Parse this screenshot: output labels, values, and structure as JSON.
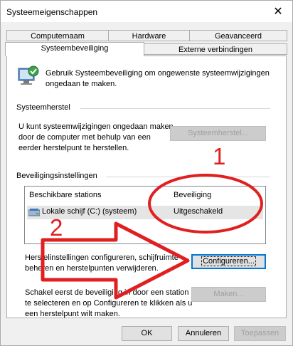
{
  "window": {
    "title": "Systeemeigenschappen",
    "close_glyph": "✕"
  },
  "tabs": {
    "row1": [
      "Computernaam",
      "Hardware",
      "Geavanceerd"
    ],
    "row2": [
      "Systeembeveiliging",
      "Externe verbindingen"
    ],
    "active": "Systeembeveiliging"
  },
  "intro": {
    "line1": "Gebruik Systeembeveiliging om ongewenste systeemwijzigingen",
    "line2": "ongedaan te maken."
  },
  "restore": {
    "title": "Systeemherstel",
    "desc": [
      "U kunt systeemwijzigingen ongedaan maken",
      "door de computer met behulp van een",
      "eerder herstelpunt te herstellen."
    ],
    "button": "Systeemherstel..."
  },
  "protection": {
    "title": "Beveiligingsinstellingen",
    "columns": [
      "Beschikbare stations",
      "Beveiliging"
    ],
    "rows": [
      {
        "drive": "Lokale schijf (C:) (systeem)",
        "status": "Uitgeschakeld"
      }
    ]
  },
  "configure": {
    "desc": [
      "Herstelinstellingen configureren, schijfruimte",
      "beheren en herstelpunten verwijderen."
    ],
    "button": "Configureren..."
  },
  "create": {
    "desc": [
      "Schakel eerst de beveiliging in door een station",
      "te selecteren en op Configureren te klikken als u",
      "een herstelpunt wilt maken."
    ],
    "button": "Maken..."
  },
  "footer": {
    "ok": "OK",
    "cancel": "Annuleren",
    "apply": "Toepassen"
  },
  "annotations": {
    "n1": "1",
    "n2": "2",
    "color": "#e02020"
  }
}
